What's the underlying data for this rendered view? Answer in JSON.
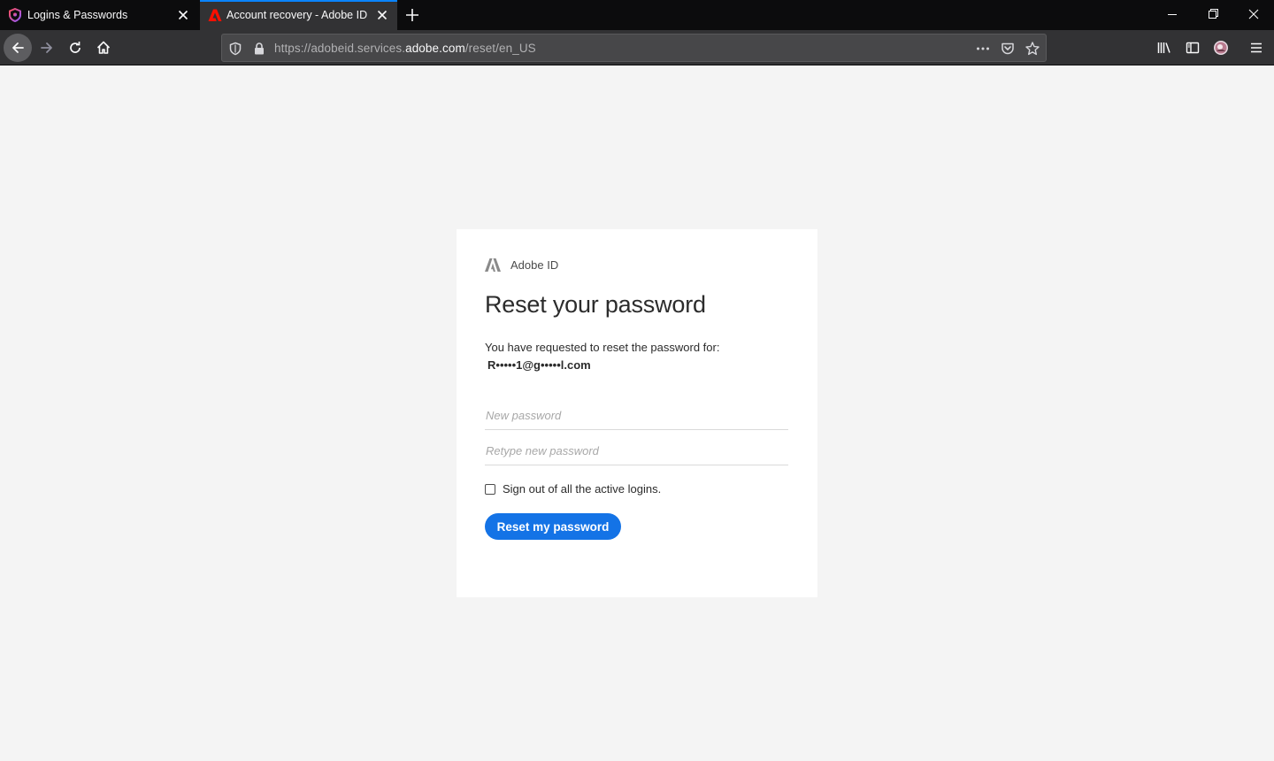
{
  "browser": {
    "tabs": [
      {
        "title": "Logins & Passwords",
        "icon": "lockwise-icon",
        "active": false
      },
      {
        "title": "Account recovery - Adobe ID",
        "icon": "adobe-icon",
        "active": true
      }
    ],
    "url": {
      "prefix": "https://adobeid.services.",
      "domain": "adobe.com",
      "path": "/reset/en_US"
    },
    "accent_color": "#0a84ff"
  },
  "page": {
    "brand_label": "Adobe ID",
    "heading": "Reset your password",
    "description": "You have requested to reset the password for:",
    "email": "R•••••1@g•••••l.com",
    "new_password_placeholder": "New password",
    "retype_password_placeholder": "Retype new password",
    "signout_label": "Sign out of all the active logins.",
    "signout_checked": false,
    "submit_label": "Reset my password",
    "button_color": "#1473e6"
  }
}
